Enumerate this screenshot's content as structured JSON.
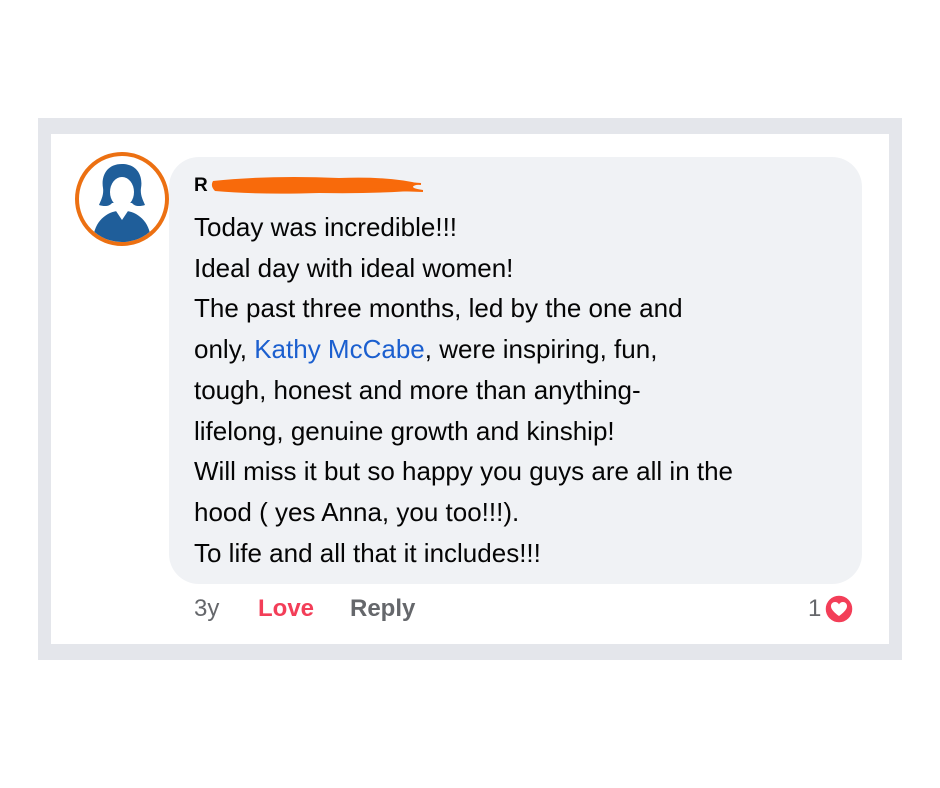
{
  "comment": {
    "author_visible": "R",
    "lines": [
      "Today was incredible!!!",
      "Ideal day with ideal women!",
      "The past three months, led by the one and"
    ],
    "line4_prefix": "only, ",
    "mention": "Kathy McCabe",
    "line4_suffix": ", were inspiring, fun,",
    "lines_after": [
      "tough, honest and more than anything-",
      "lifelong, genuine growth and kinship!",
      "Will miss it but so happy you guys are all in the",
      "hood ( yes Anna, you too!!!).",
      "To life and all that it includes!!!"
    ]
  },
  "actions": {
    "time": "3y",
    "love": "Love",
    "reply": "Reply"
  },
  "reactions": {
    "count": "1",
    "icon": "heart-icon"
  },
  "colors": {
    "frame": "#e4e6eb",
    "bubble": "#f0f2f5",
    "avatar_ring": "#ec7012",
    "avatar_figure": "#1f5e9a",
    "mention": "#1b5fcf",
    "love": "#f33e58",
    "redaction": "#f86a0b"
  }
}
